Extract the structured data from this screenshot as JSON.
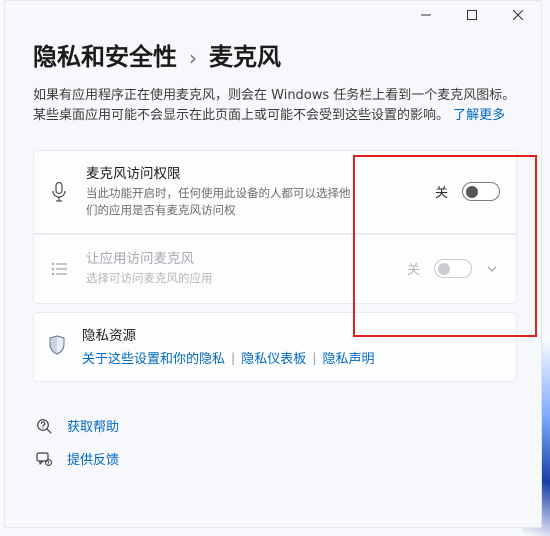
{
  "breadcrumb": {
    "parent": "隐私和安全性",
    "sep": "›",
    "current": "麦克风"
  },
  "description": "如果有应用程序正在使用麦克风，则会在 Windows 任务栏上看到一个麦克风图标。 某些桌面应用可能不会显示在此页面上或可能不会受到这些设置的影响。 ",
  "learn_more": "了解更多",
  "options": [
    {
      "title": "麦克风访问权限",
      "sub": "当此功能开启时，任何使用此设备的人都可以选择他们的应用是否有麦克风访问权",
      "state": "关"
    },
    {
      "title": "让应用访问麦克风",
      "sub": "选择可访问麦克风的应用",
      "state": "关"
    }
  ],
  "resources": {
    "title": "隐私资源",
    "link1": "关于这些设置和你的隐私",
    "link2": "隐私仪表板",
    "link3": "隐私声明"
  },
  "footer": {
    "help": "获取帮助",
    "feedback": "提供反馈"
  }
}
